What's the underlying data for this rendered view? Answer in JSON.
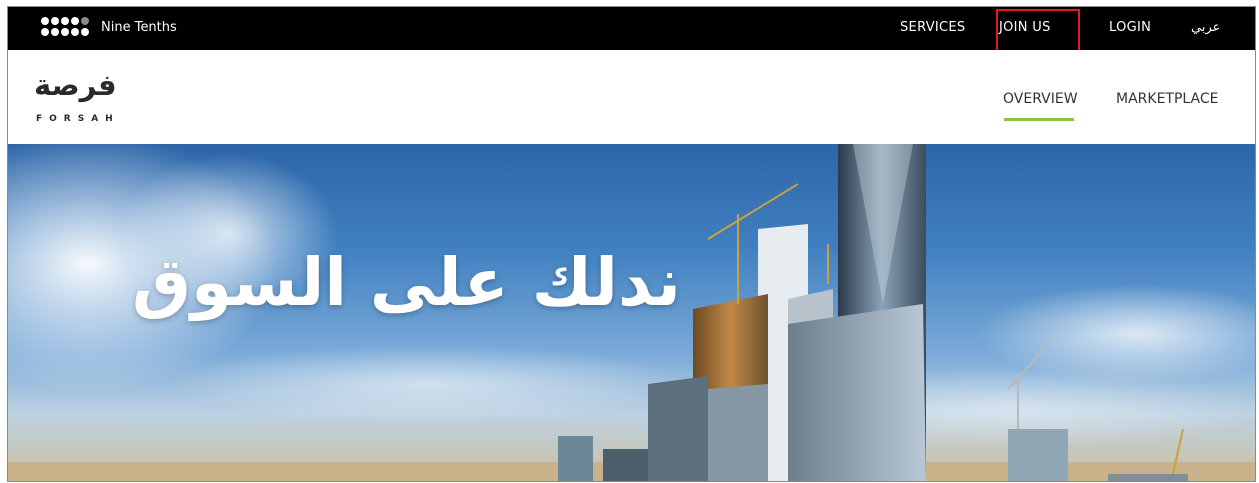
{
  "topbar": {
    "brand_name": "Nine Tenths",
    "nav": {
      "services": "SERVICES",
      "join_us": "JOIN US",
      "login": "LOGIN",
      "arabic": "عربي"
    }
  },
  "header": {
    "logo_arabic": "فرصة",
    "logo_latin": "FORSAH",
    "nav": {
      "overview": "OVERVIEW",
      "marketplace": "MARKETPLACE"
    },
    "active_tab": "OVERVIEW"
  },
  "hero": {
    "title": "ندلك على السوق"
  },
  "colors": {
    "topbar_bg": "#000000",
    "accent_underline": "#8cc63f",
    "highlight_box": "#e11a22"
  }
}
